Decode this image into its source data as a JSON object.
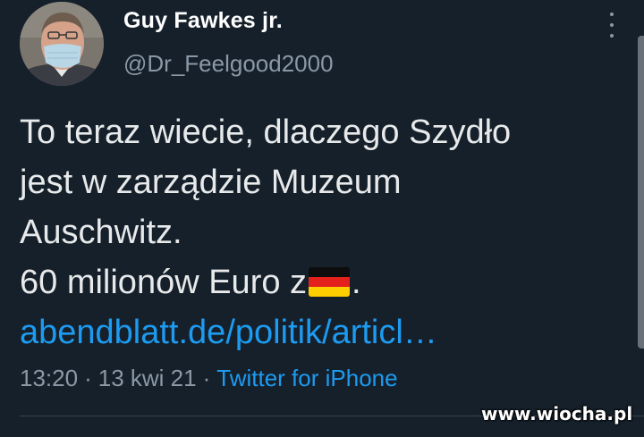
{
  "tweet": {
    "author": {
      "name": "Guy Fawkes jr.",
      "handle": "@Dr_Feelgood2000",
      "avatar_icon": "profile-photo-masked-man"
    },
    "text_lines": [
      "To teraz wiecie, dlaczego Szydło",
      "jest w zarządzie Muzeum",
      "Auschwitz.",
      "60 milionów Euro z"
    ],
    "flag_emoji": "🇩🇪",
    "trailing_punct": ".",
    "link": "abendblatt.de/politik/articl…",
    "time": "13:20",
    "separator": "·",
    "date": "13 kwi 21",
    "source": "Twitter for iPhone"
  },
  "icons": {
    "more": "more-vertical-icon"
  },
  "watermark": "www.wiocha.pl",
  "colors": {
    "background": "#15202b",
    "text": "#e7e9ea",
    "secondary": "#8b98a5",
    "link": "#1d9bf0"
  }
}
